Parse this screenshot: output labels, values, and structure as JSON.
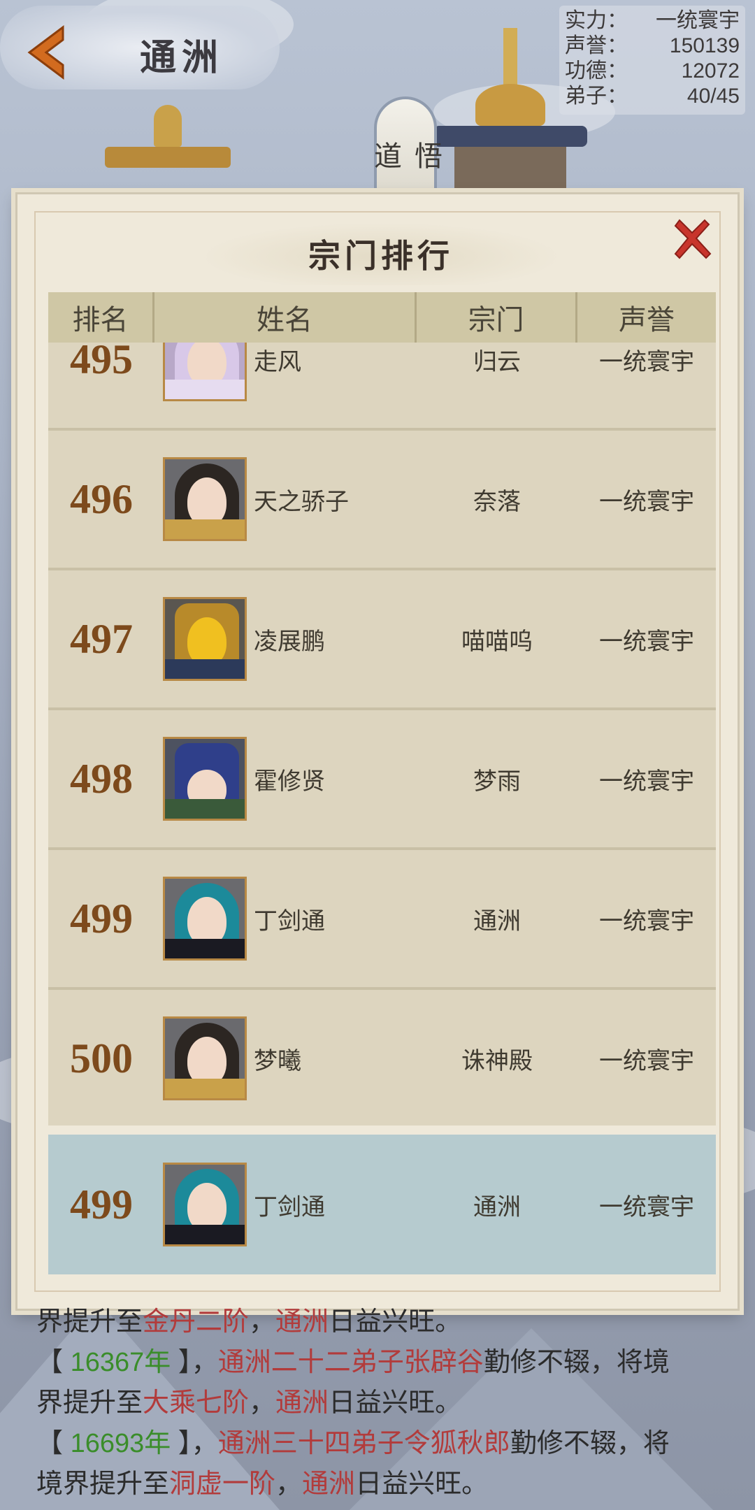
{
  "header": {
    "region_title": "通洲",
    "stats": [
      {
        "label": "实力：",
        "value": "一统寰宇"
      },
      {
        "label": "声誉：",
        "value": "150139"
      },
      {
        "label": "功德：",
        "value": "12072"
      },
      {
        "label": "弟子：",
        "value": "40/45"
      }
    ],
    "side_tab_label": "悟道"
  },
  "modal": {
    "title": "宗门排行",
    "columns": [
      "排名",
      "姓名",
      "宗门",
      "声誉"
    ],
    "rows": [
      {
        "rank": "495",
        "name": "走风",
        "sect": "归云",
        "fame": "一统寰宇",
        "avatar": "avatar-purple-hair-female"
      },
      {
        "rank": "496",
        "name": "天之骄子",
        "sect": "奈落",
        "fame": "一统寰宇",
        "avatar": "avatar-dark-hair-female"
      },
      {
        "rank": "497",
        "name": "凌展鹏",
        "sect": "喵喵呜",
        "fame": "一统寰宇",
        "avatar": "avatar-golden-helmet"
      },
      {
        "rank": "498",
        "name": "霍修贤",
        "sect": "梦雨",
        "fame": "一统寰宇",
        "avatar": "avatar-blue-gold-helmet"
      },
      {
        "rank": "499",
        "name": "丁剑通",
        "sect": "通洲",
        "fame": "一统寰宇",
        "avatar": "avatar-teal-hair-male"
      },
      {
        "rank": "500",
        "name": "梦曦",
        "sect": "诛神殿",
        "fame": "一统寰宇",
        "avatar": "avatar-dark-hair-female"
      }
    ],
    "self_row": {
      "rank": "499",
      "name": "丁剑通",
      "sect": "通洲",
      "fame": "一统寰宇",
      "avatar": "avatar-teal-hair-male"
    }
  },
  "log": {
    "line0": {
      "a": "界提升至",
      "b": "金丹二阶",
      "c": "，",
      "d": "通洲",
      "e": "日益兴旺。"
    },
    "line1": {
      "open": "【 ",
      "year": "16367年",
      "close": " 】，",
      "who": "通洲二十二弟子张辟谷",
      "act": "勤修不辍，将境"
    },
    "line2": {
      "a": "界提升至",
      "b": "大乘七阶",
      "c": "，",
      "d": "通洲",
      "e": "日益兴旺。"
    },
    "line3": {
      "open": "【 ",
      "year": "16693年",
      "close": " 】，",
      "who": "通洲三十四弟子令狐秋郎",
      "act": "勤修不辍，将"
    },
    "line4": {
      "a": "境界提升至",
      "b": "洞虚一阶",
      "c": "，",
      "d": "通洲",
      "e": "日益兴旺。"
    }
  },
  "colors": {
    "accent_red": "#b23b3b",
    "year_green": "#3a8d2a",
    "rank_brown": "#7d4a1c",
    "close_red": "#c8352c"
  }
}
